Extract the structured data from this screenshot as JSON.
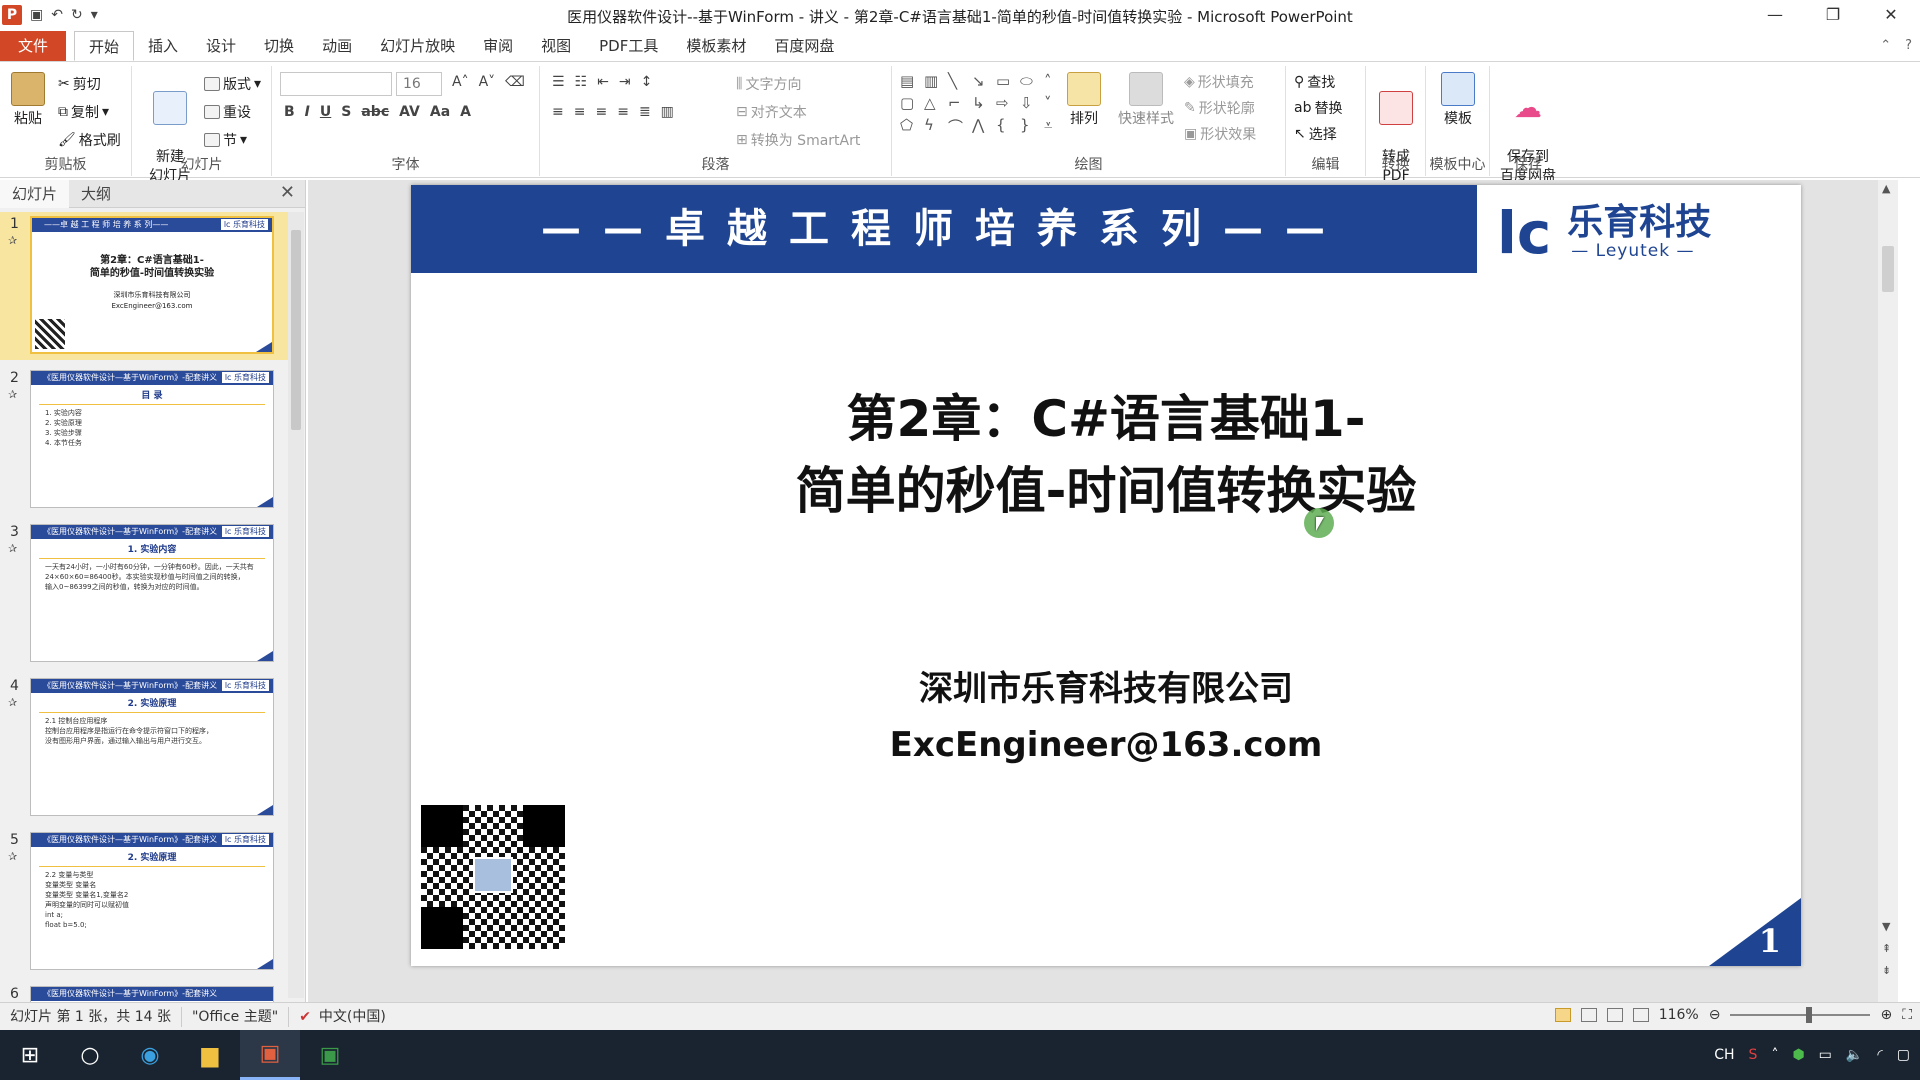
{
  "window": {
    "title": "医用仪器软件设计--基于WinForm - 讲义 - 第2章-C#语言基础1-简单的秒值-时间值转换实验 - Microsoft PowerPoint",
    "app_icon": "P",
    "controls": [
      "—",
      "❐",
      "✕"
    ]
  },
  "quick_access": [
    "save-icon",
    "undo-icon",
    "redo-icon",
    "customize-icon"
  ],
  "menu": {
    "file": "文件",
    "tabs": [
      "开始",
      "插入",
      "设计",
      "切换",
      "动画",
      "幻灯片放映",
      "审阅",
      "视图",
      "PDF工具",
      "模板素材",
      "百度网盘"
    ],
    "active_tab": "开始"
  },
  "ribbon": {
    "clipboard": {
      "paste": "粘贴",
      "cut": "剪切",
      "copy": "复制",
      "format_painter": "格式刷",
      "label": "剪贴板"
    },
    "slides": {
      "new_slide": "新建\n幻灯片",
      "layout": "版式",
      "reset": "重设",
      "section": "节",
      "label": "幻灯片"
    },
    "font": {
      "font_size": "16",
      "label": "字体"
    },
    "paragraph": {
      "text_direction": "文字方向",
      "align_text": "对齐文本",
      "smartart": "转换为 SmartArt",
      "label": "段落"
    },
    "drawing": {
      "arrange": "排列",
      "quick_styles": "快速样式",
      "shape_fill": "形状填充",
      "shape_outline": "形状轮廓",
      "shape_effects": "形状效果",
      "label": "绘图"
    },
    "editing": {
      "find": "查找",
      "replace": "替换",
      "select": "选择",
      "label": "编辑"
    },
    "convert": {
      "to_pdf": "转成\nPDF",
      "label": "转换"
    },
    "template": {
      "template": "模板",
      "label": "模板中心"
    },
    "save": {
      "save_baidu": "保存到\n百度网盘",
      "label": "保存"
    }
  },
  "left_panel": {
    "tabs": [
      "幻灯片",
      "大纲"
    ],
    "active_tab": "幻灯片",
    "thumbnails": [
      {
        "num": "1",
        "header": "——卓 越 工 程 师 培 养 系 列——",
        "title": "第2章：C#语言基础1-\n简单的秒值-时间值转换实验",
        "small": "深圳市乐育科技有限公司\nExcEngineer@163.com"
      },
      {
        "num": "2",
        "header": "《医用仪器软件设计—基于WinForm》-配套讲义",
        "sub": "目 录",
        "text": "1. 实验内容\n2. 实验原理\n3. 实验步骤\n4. 本节任务"
      },
      {
        "num": "3",
        "header": "《医用仪器软件设计—基于WinForm》-配套讲义",
        "sub": "1. 实验内容",
        "text": "一天有24小时，一小时有60分钟，一分钟有60秒。因此，一天共有\n24×60×60=86400秒。本实验实现秒值与时间值之间的转换，\n输入0~86399之间的秒值，转换为对应的时间值。"
      },
      {
        "num": "4",
        "header": "《医用仪器软件设计—基于WinForm》-配套讲义",
        "sub": "2. 实验原理",
        "text": "2.1 控制台应用程序\n控制台应用程序是指运行在命令提示符窗口下的程序，\n没有图形用户界面，通过输入输出与用户进行交互。"
      },
      {
        "num": "5",
        "header": "《医用仪器软件设计—基于WinForm》-配套讲义",
        "sub": "2. 实验原理",
        "text": "2.2 变量与类型\n变量类型  变量名\n变量类型 变量名1,变量名2\n声明变量的同时可以赋初值\nint a;\nfloat b=5.0;"
      },
      {
        "num": "6",
        "header": "《医用仪器软件设计—基于WinForm》-配套讲义"
      }
    ]
  },
  "slide": {
    "banner": "——卓越工程师培养系列——",
    "logo_mark": "lc",
    "logo_cn": "乐育科技",
    "logo_en": "— Leyutek —",
    "title_line1": "第2章：C#语言基础1-",
    "title_line2": "简单的秒值-时间值转换实验",
    "company": "深圳市乐育科技有限公司",
    "email": "ExcEngineer@163.com",
    "page_number": "1"
  },
  "status": {
    "slide_info": "幻灯片 第 1 张，共 14 张",
    "theme": "\"Office 主题\"",
    "language": "中文(中国)",
    "zoom": "116%"
  },
  "taskbar": {
    "tray_lang": "CH",
    "tray_icons": [
      "chevron-up-icon",
      "network-icon",
      "battery-icon",
      "volume-icon",
      "wifi-icon",
      "notification-icon"
    ]
  },
  "colors": {
    "accent": "#d24726",
    "slide_blue": "#1f4592",
    "logo_orange": "#e38a1e"
  }
}
